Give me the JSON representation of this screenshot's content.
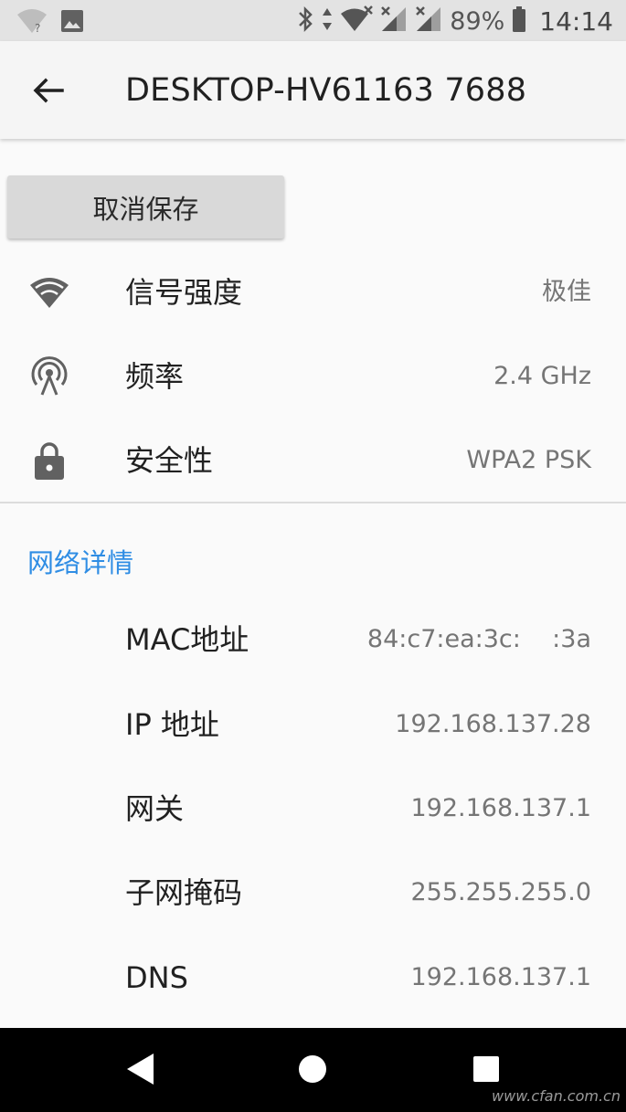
{
  "status_bar": {
    "battery_text": "89%",
    "time": "14:14",
    "icons": [
      "wifi-unknown-icon",
      "image-notification-icon",
      "bluetooth-icon",
      "data-arrows-icon",
      "wifi-x-icon",
      "signal-x-icon",
      "signal-x-icon",
      "battery-icon"
    ]
  },
  "app_bar": {
    "back_icon": "arrow-left-icon",
    "title": "DESKTOP-HV61163 7688"
  },
  "actions": {
    "forget_label": "取消保存"
  },
  "summary_rows": [
    {
      "icon": "wifi-signal-icon",
      "label": "信号强度",
      "value": "极佳"
    },
    {
      "icon": "antenna-icon",
      "label": "频率",
      "value": "2.4 GHz"
    },
    {
      "icon": "lock-icon",
      "label": "安全性",
      "value": "WPA2 PSK"
    }
  ],
  "network_details": {
    "header": "网络详情",
    "rows": [
      {
        "label": "MAC地址",
        "value": "84:c7:ea:3c:    :3a"
      },
      {
        "label": "IP 地址",
        "value": "192.168.137.28"
      },
      {
        "label": "网关",
        "value": "192.168.137.1"
      },
      {
        "label": "子网掩码",
        "value": "255.255.255.0"
      },
      {
        "label": "DNS",
        "value": "192.168.137.1"
      }
    ]
  },
  "nav_bar": {
    "icons": [
      "back-triangle-icon",
      "home-circle-icon",
      "recents-square-icon"
    ]
  },
  "watermark": "www.cfan.com.cn",
  "colors": {
    "accent": "#2f8de4",
    "status_bar_bg": "#e3e3e3",
    "app_bar_bg": "#f5f5f5",
    "page_bg": "#fafafa",
    "button_bg": "#d9d9d9",
    "nav_bar_bg": "#000000"
  }
}
